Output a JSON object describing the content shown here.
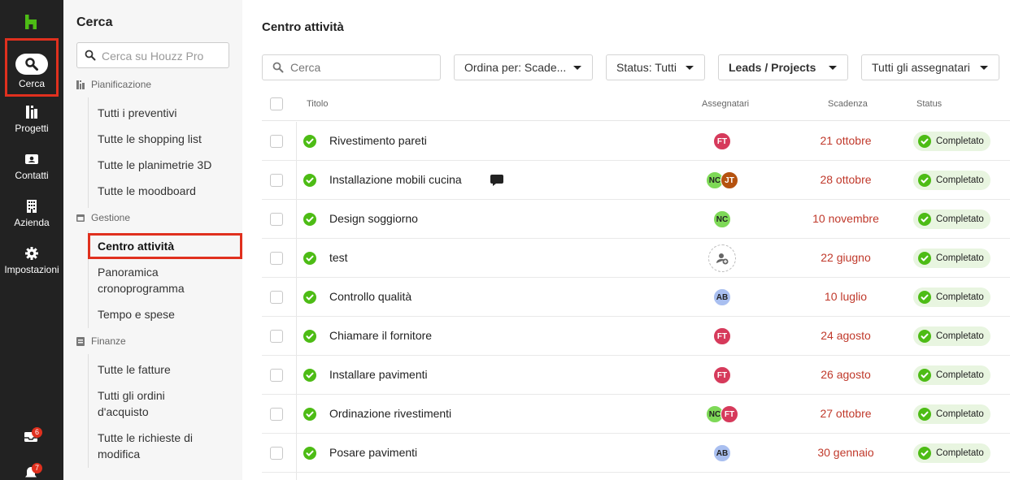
{
  "colors": {
    "brand": "#4dbc15",
    "rail_bg": "#222222",
    "due_red": "#c0392b",
    "status_bg": "#e8f5e0",
    "highlight": "#e0301e"
  },
  "rail": {
    "logo_icon": "houzz-logo-icon",
    "items": [
      {
        "label": "Cerca",
        "icon": "search-icon"
      },
      {
        "label": "Progetti",
        "icon": "projects-icon"
      },
      {
        "label": "Contatti",
        "icon": "contacts-icon"
      },
      {
        "label": "Azienda",
        "icon": "building-icon"
      },
      {
        "label": "Impostazioni",
        "icon": "gear-icon"
      }
    ],
    "inbox_badge": "6",
    "bell_badge": "7"
  },
  "sidebar": {
    "title": "Cerca",
    "search_placeholder": "Cerca su Houzz Pro",
    "sections": [
      {
        "label": "Pianificazione",
        "items": [
          "Tutti i preventivi",
          "Tutte le shopping list",
          "Tutte le planimetrie 3D",
          "Tutte le moodboard"
        ]
      },
      {
        "label": "Gestione",
        "items": [
          "Centro attività",
          "Panoramica cronoprogramma",
          "Tempo e spese"
        ]
      },
      {
        "label": "Finanze",
        "items": [
          "Tutte le fatture",
          "Tutti gli ordini d'acquisto",
          "Tutte le richieste di modifica"
        ]
      }
    ]
  },
  "main": {
    "title": "Centro attività",
    "search_placeholder": "Cerca",
    "sort_label": "Ordina per: Scade...",
    "status_label": "Status: Tutti",
    "type_label": "Leads / Projects",
    "assignee_label": "Tutti gli assegnatari",
    "columns": {
      "title": "Titolo",
      "assignees": "Assegnatari",
      "due": "Scadenza",
      "status": "Status"
    },
    "rows": [
      {
        "title": "Rivestimento pareti",
        "due": "21 ottobre",
        "status": "Completato",
        "assignees": [
          "FT"
        ]
      },
      {
        "title": "Installazione mobili cucina",
        "due": "28 ottobre",
        "status": "Completato",
        "assignees": [
          "NC",
          "JT"
        ],
        "comment": true
      },
      {
        "title": "Design soggiorno",
        "due": "10 novembre",
        "status": "Completato",
        "assignees": [
          "NC"
        ]
      },
      {
        "title": "test",
        "due": "22 giugno",
        "status": "Completato",
        "assignees": []
      },
      {
        "title": "Controllo qualità",
        "due": "10 luglio",
        "status": "Completato",
        "assignees": [
          "AB"
        ]
      },
      {
        "title": "Chiamare il fornitore",
        "due": "24 agosto",
        "status": "Completato",
        "assignees": [
          "FT"
        ]
      },
      {
        "title": "Installare pavimenti",
        "due": "26 agosto",
        "status": "Completato",
        "assignees": [
          "FT"
        ]
      },
      {
        "title": "Ordinazione rivestimenti",
        "due": "27 ottobre",
        "status": "Completato",
        "assignees": [
          "NC",
          "FT"
        ]
      },
      {
        "title": "Posare pavimenti",
        "due": "30 gennaio",
        "status": "Completato",
        "assignees": [
          "AB"
        ]
      }
    ]
  }
}
